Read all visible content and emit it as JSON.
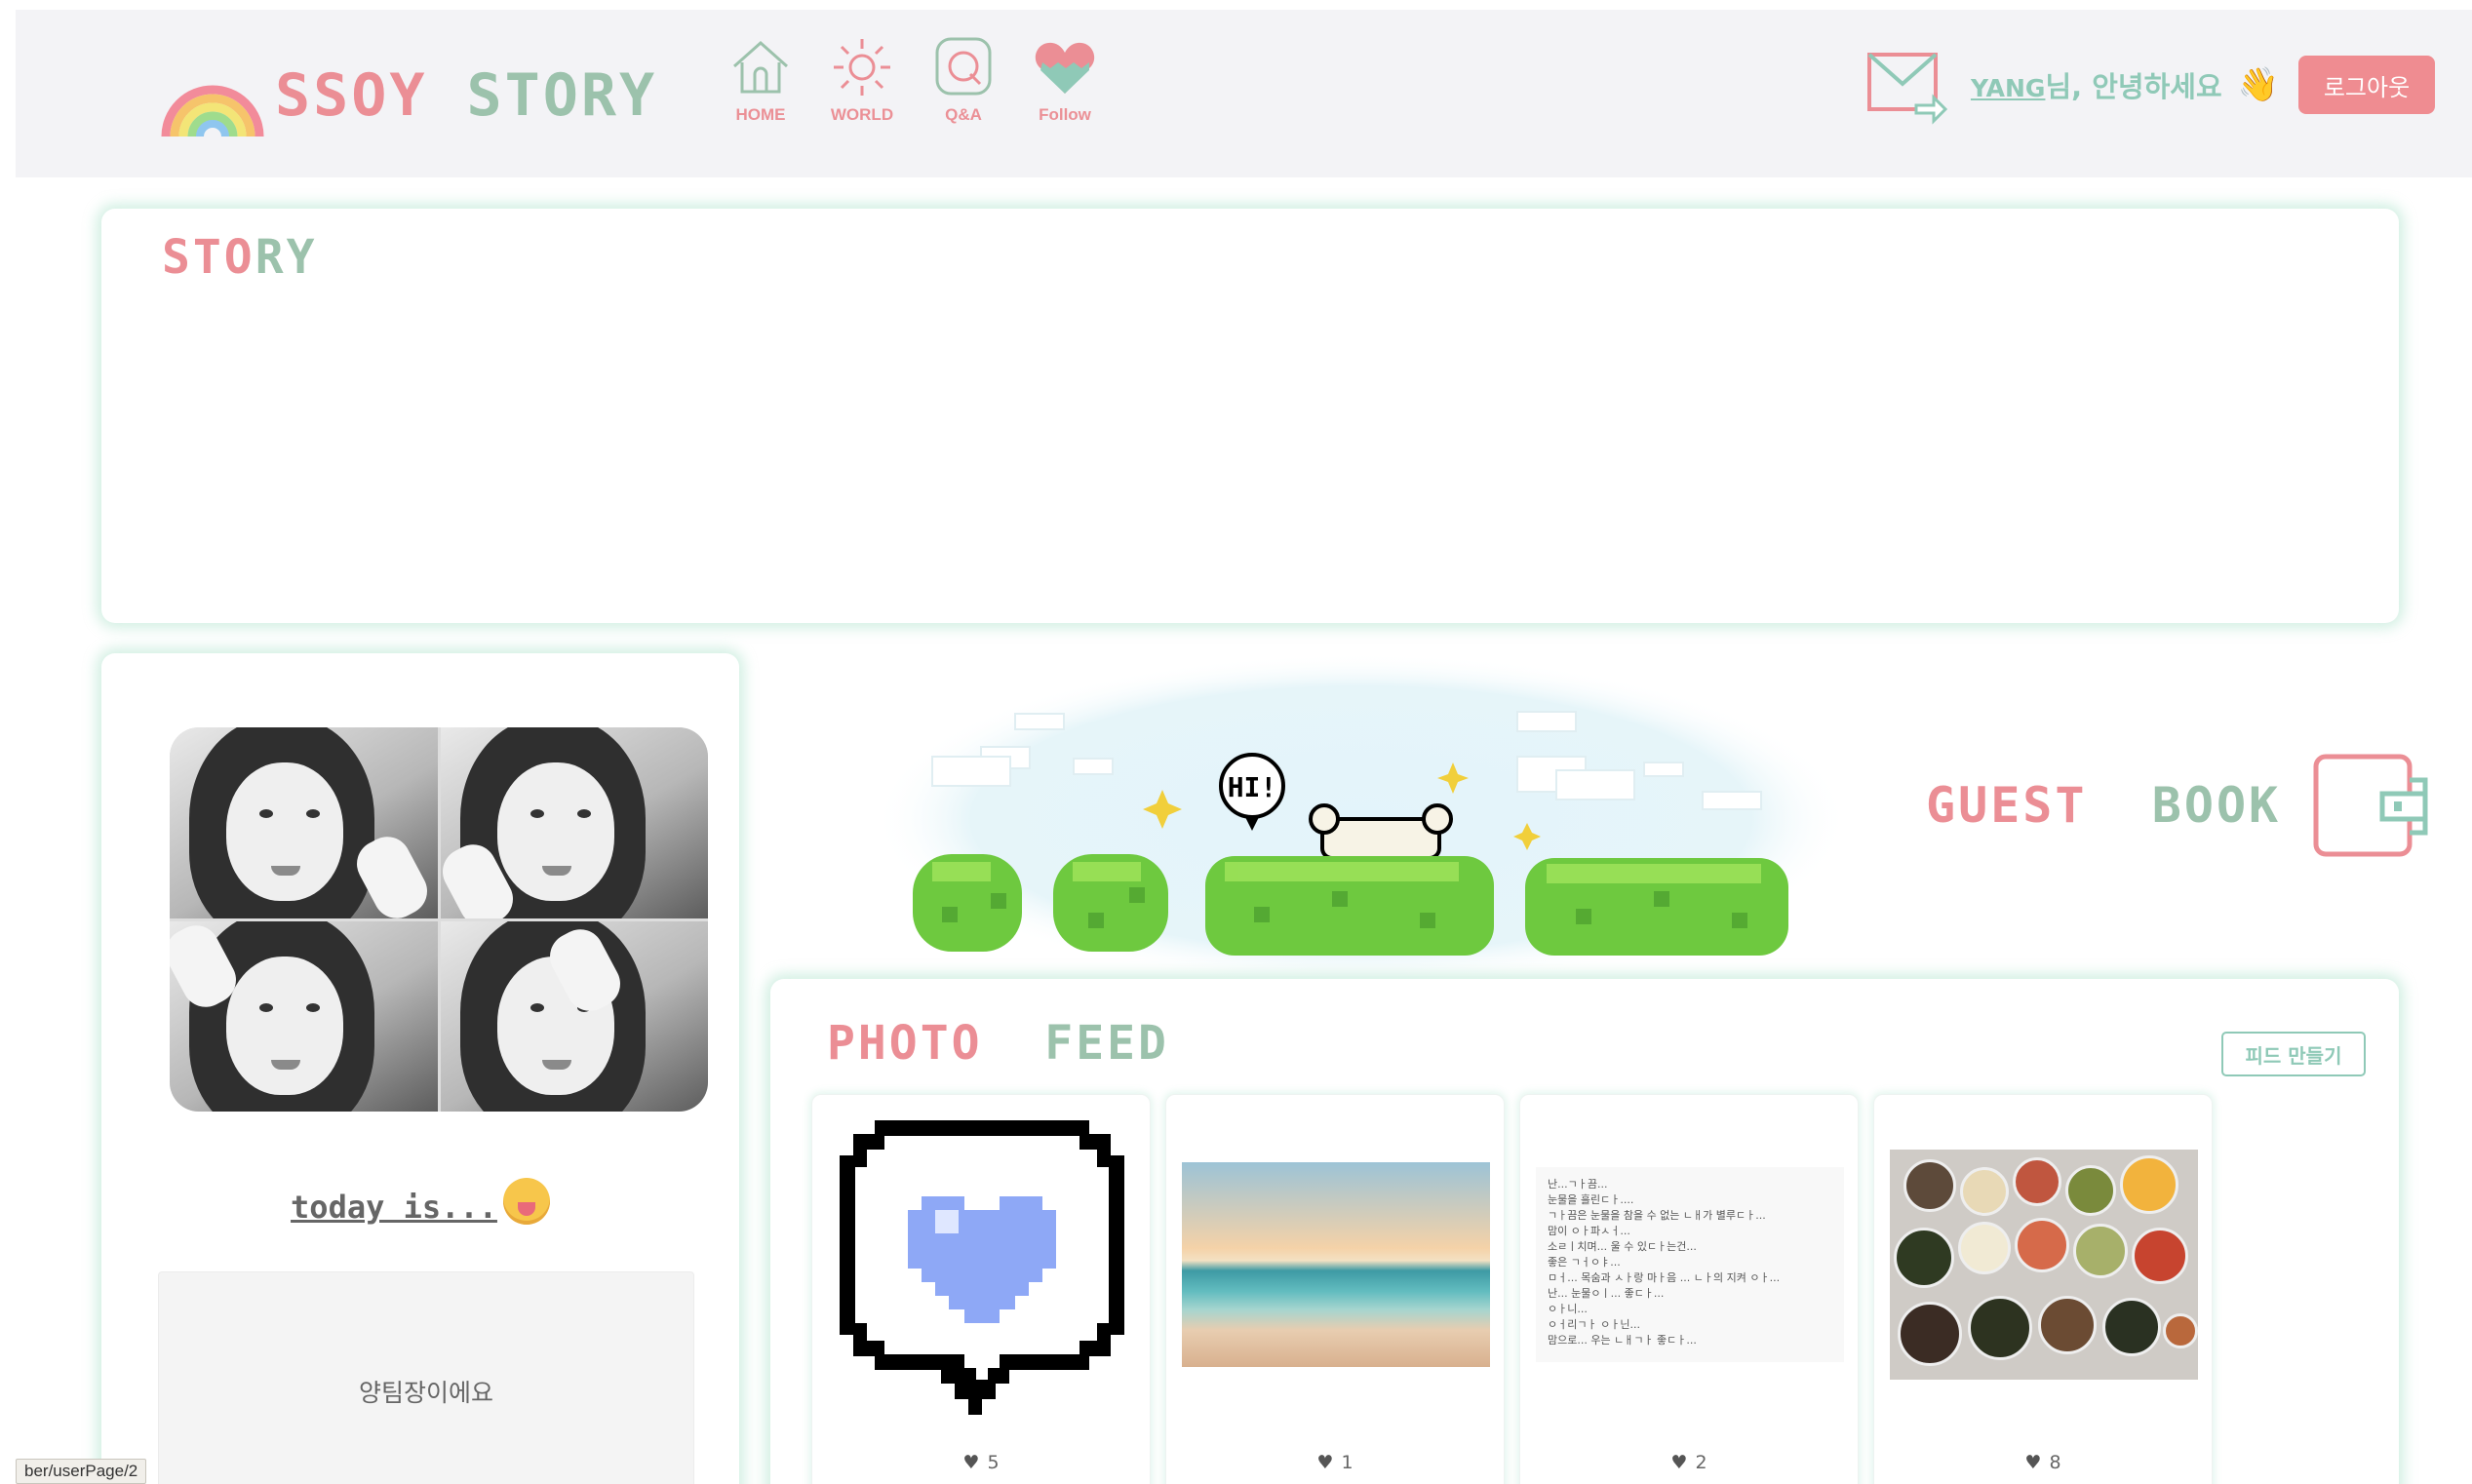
{
  "header": {
    "brand": {
      "word1": "SSOY",
      "word2": "STORY"
    },
    "nav": [
      {
        "label": "HOME",
        "icon": "home-icon"
      },
      {
        "label": "WORLD",
        "icon": "sun-icon"
      },
      {
        "label": "Q&A",
        "icon": "qna-icon"
      },
      {
        "label": "Follow",
        "icon": "heart-icon"
      }
    ],
    "user": {
      "username": "YANG",
      "greeting": "님, 안녕하세요",
      "wave": "👋",
      "logout_label": "로그아웃"
    }
  },
  "story": {
    "title_part1": "STO",
    "title_part2": "RY"
  },
  "profile": {
    "today_label": "today is...",
    "status_text": "양팀장이에요"
  },
  "scene": {
    "speech": "HI!"
  },
  "guestbook": {
    "word1": "GUEST",
    "word2": "BOOK"
  },
  "feed": {
    "title_word1": "PHOTO",
    "title_word2": "FEED",
    "create_label": "피드 만들기",
    "cards": [
      {
        "image": "pixel-heart-speech-bubble",
        "likes": "5"
      },
      {
        "image": "beach-sunset-photo",
        "likes": "1"
      },
      {
        "image": "handwritten-note-photo",
        "likes": "2",
        "note_text": "난...ㄱㅏ끔...\n눈물을 흘린ㄷㅏ....\nㄱㅏ끔은 눈물을 참을 수 없는 ㄴㅐ가 별루ㄷㅏ...\n맘이 ㅇㅏ파ㅅㅓ...\n소ㄹㅣ치며... 울 수 있ㄷㅏ는건...\n좋은 ㄱㅓㅇㅑ...\nㅁㅓ... 목숨과 ㅅㅏ랑 마ㅏ음 ... ㄴㅏ의 지켜 ㅇㅏ...\n난... 눈물ㅇㅣ... 좋ㄷㅏ...\nㅇㅏ니...\nㅇㅓ리ㄱㅏ ㅇㅏ닌...\n맘으로... 우는 ㄴㅐㄱㅏ 좋ㄷㅏ..."
      },
      {
        "image": "korean-food-table-photo",
        "likes": "8"
      }
    ]
  },
  "status_bar": {
    "url": "ber/userPage/2"
  },
  "colors": {
    "brand_pink": "#eb8e95",
    "brand_mint": "#9cc2ac",
    "accent_mint": "#8fc9b7",
    "logout_bg": "#ef8c91",
    "header_bg": "#f3f3f6"
  }
}
